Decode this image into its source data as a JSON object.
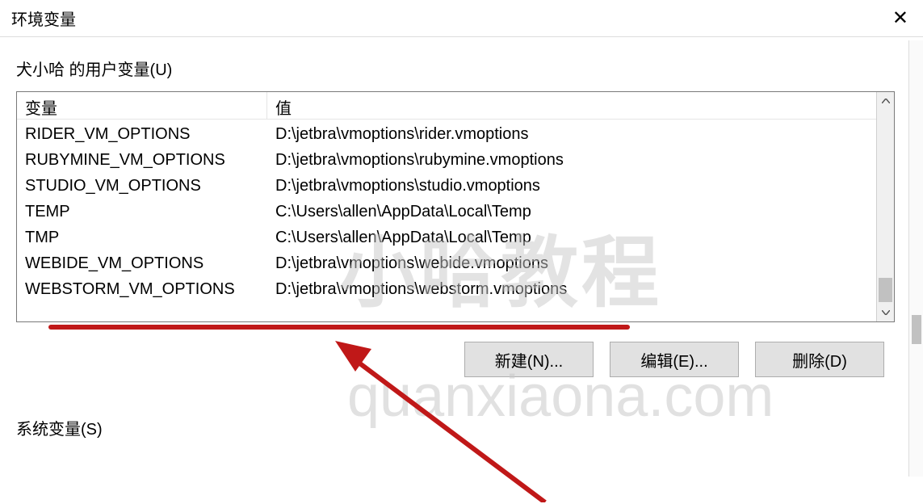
{
  "window": {
    "title": "环境变量"
  },
  "userVars": {
    "label": "犬小哈 的用户变量(U)",
    "columns": {
      "variable": "变量",
      "value": "值"
    },
    "rows": [
      {
        "var": "RIDER_VM_OPTIONS",
        "val": "D:\\jetbra\\vmoptions\\rider.vmoptions"
      },
      {
        "var": "RUBYMINE_VM_OPTIONS",
        "val": "D:\\jetbra\\vmoptions\\rubymine.vmoptions"
      },
      {
        "var": "STUDIO_VM_OPTIONS",
        "val": "D:\\jetbra\\vmoptions\\studio.vmoptions"
      },
      {
        "var": "TEMP",
        "val": "C:\\Users\\allen\\AppData\\Local\\Temp"
      },
      {
        "var": "TMP",
        "val": "C:\\Users\\allen\\AppData\\Local\\Temp"
      },
      {
        "var": "WEBIDE_VM_OPTIONS",
        "val": "D:\\jetbra\\vmoptions\\webide.vmoptions"
      },
      {
        "var": "WEBSTORM_VM_OPTIONS",
        "val": "D:\\jetbra\\vmoptions\\webstorm.vmoptions"
      }
    ]
  },
  "buttons": {
    "new": "新建(N)...",
    "edit": "编辑(E)...",
    "delete": "删除(D)"
  },
  "systemVars": {
    "label": "系统变量(S)"
  },
  "watermark": {
    "line1": "小哈教程",
    "line2": "quanxiaona.com"
  },
  "annotation": {
    "color": "#c01818"
  }
}
